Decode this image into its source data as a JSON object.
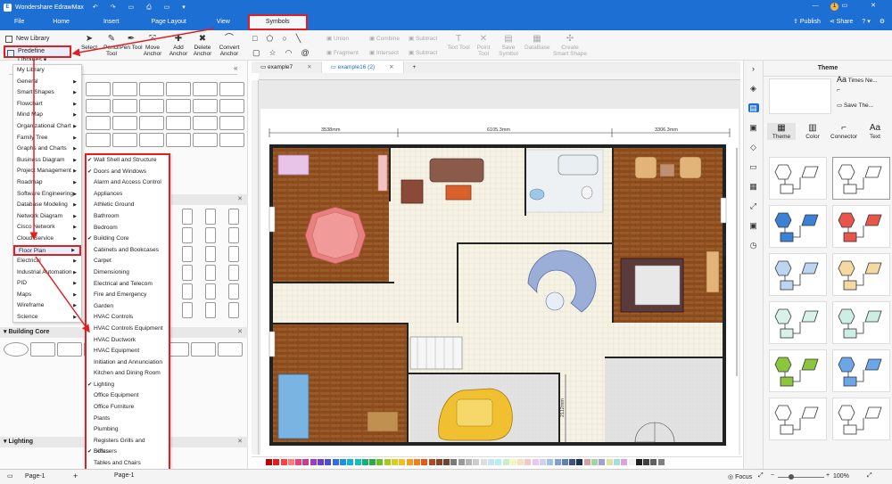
{
  "app": {
    "title": "Wondershare EdrawMax",
    "publish": "Publish",
    "share": "Share",
    "user_initial": "1"
  },
  "menubar": {
    "items": [
      "File",
      "Home",
      "Insert",
      "Page Layout",
      "View",
      "Symbols"
    ]
  },
  "toolbar": {
    "new_library": "New Library",
    "predefined_libraries": "Predefine Libraries",
    "tools": [
      {
        "label": "Select",
        "icon": "arrow-pointer-icon"
      },
      {
        "label": "Pencil Tool",
        "icon": "pencil-icon"
      },
      {
        "label": "Pen Tool",
        "icon": "pen-icon"
      },
      {
        "label": "Move Anchor",
        "icon": "move-anchor-icon"
      },
      {
        "label": "Add Anchor",
        "icon": "add-anchor-icon"
      },
      {
        "label": "Delete Anchor",
        "icon": "delete-anchor-icon"
      },
      {
        "label": "Convert Anchor",
        "icon": "convert-anchor-icon"
      }
    ],
    "boolean_ops": [
      "Union",
      "Combine",
      "Subtract",
      "Fragment",
      "Intersect",
      "Subtract"
    ],
    "format_tools": [
      "Text Tool",
      "Point Tool",
      "Save Symbol",
      "DataBase",
      "Create Smart Shape"
    ]
  },
  "library_menu": {
    "items": [
      "My Library",
      "General",
      "Smart Shapes",
      "Flowchart",
      "Mind Map",
      "Organizational Chart",
      "Family Tree",
      "Graphs and Charts",
      "Business Diagram",
      "Project Management",
      "Roadmap",
      "Software Engineering",
      "Database Modeling",
      "Network Diagram",
      "Cisco Network",
      "Cloud Service",
      "Floor Plan",
      "Electrical",
      "Industrial Automation",
      "PID",
      "Maps",
      "Wireframe",
      "Science"
    ],
    "selected": "Floor Plan"
  },
  "floorplan_submenu": {
    "items": [
      {
        "label": "Wall Shell and Structure",
        "checked": true
      },
      {
        "label": "Doors and Windows",
        "checked": true
      },
      {
        "label": "Alarm and Access Control",
        "checked": false
      },
      {
        "label": "Appliances",
        "checked": false
      },
      {
        "label": "Athletic Ground",
        "checked": false
      },
      {
        "label": "Bathroom",
        "checked": false
      },
      {
        "label": "Bedroom",
        "checked": false
      },
      {
        "label": "Building Core",
        "checked": true
      },
      {
        "label": "Cabinets and Bookcases",
        "checked": false
      },
      {
        "label": "Carpet",
        "checked": false
      },
      {
        "label": "Dimensioning",
        "checked": false
      },
      {
        "label": "Electrical and Telecom",
        "checked": false
      },
      {
        "label": "Fire and Emergency",
        "checked": false
      },
      {
        "label": "Garden",
        "checked": false
      },
      {
        "label": "HVAC Controls",
        "checked": false
      },
      {
        "label": "HVAC Controls Equipment",
        "checked": false
      },
      {
        "label": "HVAC Ductwork",
        "checked": false
      },
      {
        "label": "HVAC Equipment",
        "checked": false
      },
      {
        "label": "Initiation and Annunciation",
        "checked": false
      },
      {
        "label": "Kitchen and Dining Room",
        "checked": false
      },
      {
        "label": "Lighting",
        "checked": true
      },
      {
        "label": "Office Equipment",
        "checked": false
      },
      {
        "label": "Office Furniture",
        "checked": false
      },
      {
        "label": "Plants",
        "checked": false
      },
      {
        "label": "Plumbing",
        "checked": false
      },
      {
        "label": "Registers Grills and Diffusers",
        "checked": false
      },
      {
        "label": "Sofas",
        "checked": true
      },
      {
        "label": "Tables and Chairs",
        "checked": false
      },
      {
        "label": "Video Surveillance",
        "checked": false
      }
    ]
  },
  "left_panel": {
    "sections": [
      "Building Core",
      "Lighting"
    ]
  },
  "tabs": [
    {
      "label": "example7",
      "active": false
    },
    {
      "label": "example16 (2)",
      "active": true
    }
  ],
  "floorplan": {
    "dim_top": [
      "3538mm",
      "6105.3mm",
      "3306.3mm"
    ],
    "dim_right": "6393.6mm",
    "dim_garage": "2112mm"
  },
  "theme_panel": {
    "title": "Theme",
    "font_name": "Times Ne...",
    "save_theme": "Save The...",
    "tabs": [
      "Theme",
      "Color",
      "Connector",
      "Text"
    ],
    "theme_colors": [
      [
        "#ffffff",
        "#ffffff"
      ],
      [
        "#3b82d6",
        "#e8564b"
      ],
      [
        "#bcd5f2",
        "#f5d9a3"
      ],
      [
        "#d8f1ea",
        "#cdeee4"
      ],
      [
        "#8cc63f",
        "#6aa6e8"
      ],
      [
        "#ffffff",
        "#ffffff"
      ]
    ]
  },
  "status": {
    "page": "Page-1",
    "focus": "Focus",
    "zoom": "100%"
  },
  "palette": [
    "#c00000",
    "#e02020",
    "#ff4040",
    "#ff7a7a",
    "#e0457b",
    "#c83c96",
    "#9b3fc1",
    "#6a3fc1",
    "#4b4fd1",
    "#2f6fe0",
    "#1e90e0",
    "#19b0d8",
    "#16c0b8",
    "#14b07a",
    "#2ea84a",
    "#6cc02a",
    "#a8c82a",
    "#d8d020",
    "#f0c020",
    "#f0a020",
    "#f08020",
    "#e05a1a",
    "#b04a20",
    "#884420",
    "#704030",
    "#7a7a7a",
    "#999999",
    "#b5b5b5",
    "#cccccc",
    "#dddddd",
    "#c7e4f5",
    "#b4f0ee",
    "#c8f0c8",
    "#f5f5c0",
    "#f5e0c0",
    "#f5c8c8",
    "#e8c8f0",
    "#d0d0f5",
    "#a0c0e8",
    "#80a0d0",
    "#6080b0",
    "#405080",
    "#203050",
    "#d4a0a0",
    "#a0d4a0",
    "#a0a0d4",
    "#e0e0a0",
    "#a0e0e0",
    "#e0a0e0",
    "#f0f0f0",
    "#202020",
    "#404040",
    "#606060",
    "#808080"
  ]
}
